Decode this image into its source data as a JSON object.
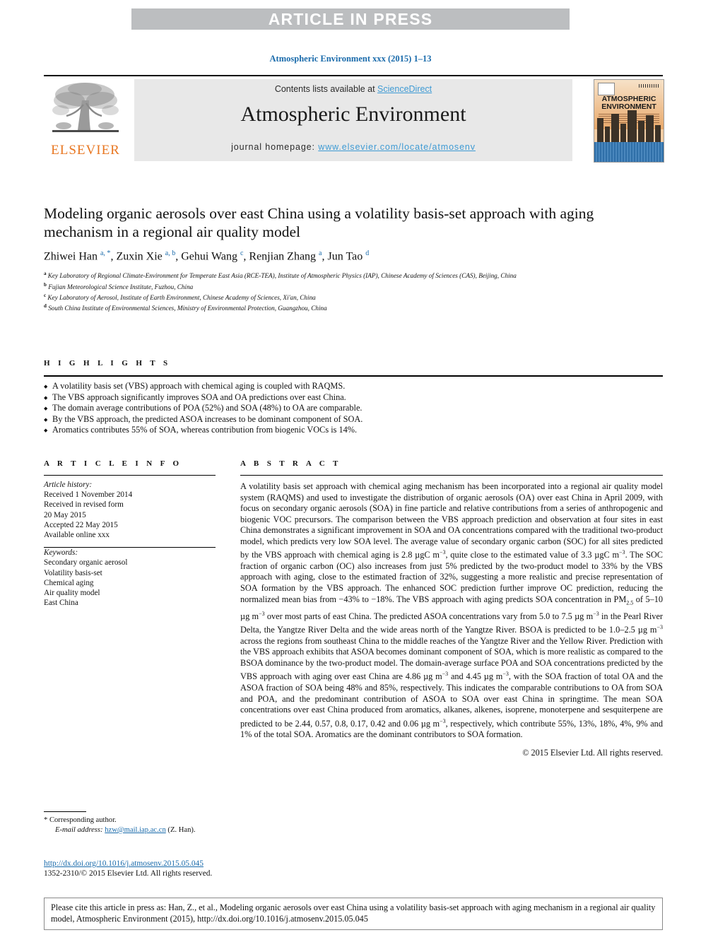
{
  "banner": {
    "label": "ARTICLE IN PRESS"
  },
  "journal_ref": "Atmospheric Environment xxx (2015) 1–13",
  "masthead": {
    "contents_prefix": "Contents lists available at ",
    "sciencedirect": "ScienceDirect",
    "journal_title": "Atmospheric Environment",
    "homepage_prefix": "journal homepage: ",
    "homepage_url": "www.elsevier.com/locate/atmosenv",
    "publisher": "ELSEVIER",
    "cover_title_line1": "ATMOSPHERIC",
    "cover_title_line2": "ENVIRONMENT",
    "accent_link_color": "#3f9bd4",
    "publisher_color": "#e87722"
  },
  "article": {
    "title": "Modeling organic aerosols over east China using a volatility basis-set approach with aging mechanism in a regional air quality model",
    "authors": [
      {
        "name": "Zhiwei Han",
        "marks": "a, *"
      },
      {
        "name": "Zuxin Xie",
        "marks": "a, b"
      },
      {
        "name": "Gehui Wang",
        "marks": "c"
      },
      {
        "name": "Renjian Zhang",
        "marks": "a"
      },
      {
        "name": "Jun Tao",
        "marks": "d"
      }
    ],
    "affiliations": [
      {
        "mark": "a",
        "text": "Key Laboratory of Regional Climate-Environment for Temperate East Asia (RCE-TEA), Institute of Atmospheric Physics (IAP), Chinese Academy of Sciences (CAS), Beijing, China"
      },
      {
        "mark": "b",
        "text": "Fujian Meteorological Science Institute, Fuzhou, China"
      },
      {
        "mark": "c",
        "text": "Key Laboratory of Aerosol, Institute of Earth Environment, Chinese Academy of Sciences, Xi'an, China"
      },
      {
        "mark": "d",
        "text": "South China Institute of Environmental Sciences, Ministry of Environmental Protection, Guangzhou, China"
      }
    ]
  },
  "highlights": {
    "heading": "H I G H L I G H T S",
    "items": [
      "A volatility basis set (VBS) approach with chemical aging is coupled with RAQMS.",
      "The VBS approach significantly improves SOA and OA predictions over east China.",
      "The domain average contributions of POA (52%) and SOA (48%) to OA are comparable.",
      "By the VBS approach, the predicted ASOA increases to be dominant component of SOA.",
      "Aromatics contributes 55% of SOA, whereas contribution from biogenic VOCs is 14%."
    ]
  },
  "article_info": {
    "heading": "A R T I C L E  I N F O",
    "history_label": "Article history:",
    "history": [
      "Received 1 November 2014",
      "Received in revised form",
      "20 May 2015",
      "Accepted 22 May 2015",
      "Available online xxx"
    ],
    "keywords_label": "Keywords:",
    "keywords": [
      "Secondary organic aerosol",
      "Volatility basis-set",
      "Chemical aging",
      "Air quality model",
      "East China"
    ]
  },
  "abstract": {
    "heading": "A B S T R A C T",
    "paragraph_html": "A volatility basis set approach with chemical aging mechanism has been incorporated into a regional air quality model system (RAQMS) and used to investigate the distribution of organic aerosols (OA) over east China in April 2009, with focus on secondary organic aerosols (SOA) in fine particle and relative contributions from a series of anthropogenic and biogenic VOC precursors. The comparison between the VBS approach prediction and observation at four sites in east China demonstrates a significant improvement in SOA and OA concentrations compared with the traditional two-product model, which predicts very low SOA level. The average value of secondary organic carbon (SOC) for all sites predicted by the VBS approach with chemical aging is 2.8 µgC m<sup class=\"sm\">−3</sup>, quite close to the estimated value of 3.3 µgC m<sup class=\"sm\">−3</sup>. The SOC fraction of organic carbon (OC) also increases from just 5% predicted by the two-product model to 33% by the VBS approach with aging, close to the estimated fraction of 32%, suggesting a more realistic and precise representation of SOA formation by the VBS approach. The enhanced SOC prediction further improve OC prediction, reducing the normalized mean bias from −43% to −18%. The VBS approach with aging predicts SOA concentration in PM<sub class=\"sm\">2.5</sub> of 5–10 µg m<sup class=\"sm\">−3</sup> over most parts of east China. The predicted ASOA concentrations vary from 5.0 to 7.5 µg m<sup class=\"sm\">−3</sup> in the Pearl River Delta, the Yangtze River Delta and the wide areas north of the Yangtze River. BSOA is predicted to be 1.0–2.5 µg m<sup class=\"sm\">−3</sup> across the regions from southeast China to the middle reaches of the Yangtze River and the Yellow River. Prediction with the VBS approach exhibits that ASOA becomes dominant component of SOA, which is more realistic as compared to the BSOA dominance by the two-product model. The domain-average surface POA and SOA concentrations predicted by the VBS approach with aging over east China are 4.86 µg m<sup class=\"sm\">−3</sup> and 4.45 µg m<sup class=\"sm\">−3</sup>, with the SOA fraction of total OA and the ASOA fraction of SOA being 48% and 85%, respectively. This indicates the comparable contributions to OA from SOA and POA, and the predominant contribution of ASOA to SOA over east China in springtime. The mean SOA concentrations over east China produced from aromatics, alkanes, alkenes, isoprene, monoterpene and sesquiterpene are predicted to be 2.44, 0.57, 0.8, 0.17, 0.42 and 0.06 µg m<sup class=\"sm\">−3</sup>, respectively, which contribute 55%, 13%, 18%, 4%, 9% and 1% of the total SOA. Aromatics are the dominant contributors to SOA formation.",
    "copyright": "© 2015 Elsevier Ltd. All rights reserved."
  },
  "footnote": {
    "corresponding": "* Corresponding author.",
    "email_label": "E-mail address:",
    "email": "hzw@mail.iap.ac.cn",
    "email_suffix": "(Z. Han)."
  },
  "doi": {
    "url": "http://dx.doi.org/10.1016/j.atmosenv.2015.05.045",
    "issn": "1352-2310/© 2015 Elsevier Ltd. All rights reserved."
  },
  "cite_box": {
    "text": "Please cite this article in press as: Han, Z., et al., Modeling organic aerosols over east China using a volatility basis-set approach with aging mechanism in a regional air quality model, Atmospheric Environment (2015), http://dx.doi.org/10.1016/j.atmosenv.2015.05.045"
  }
}
